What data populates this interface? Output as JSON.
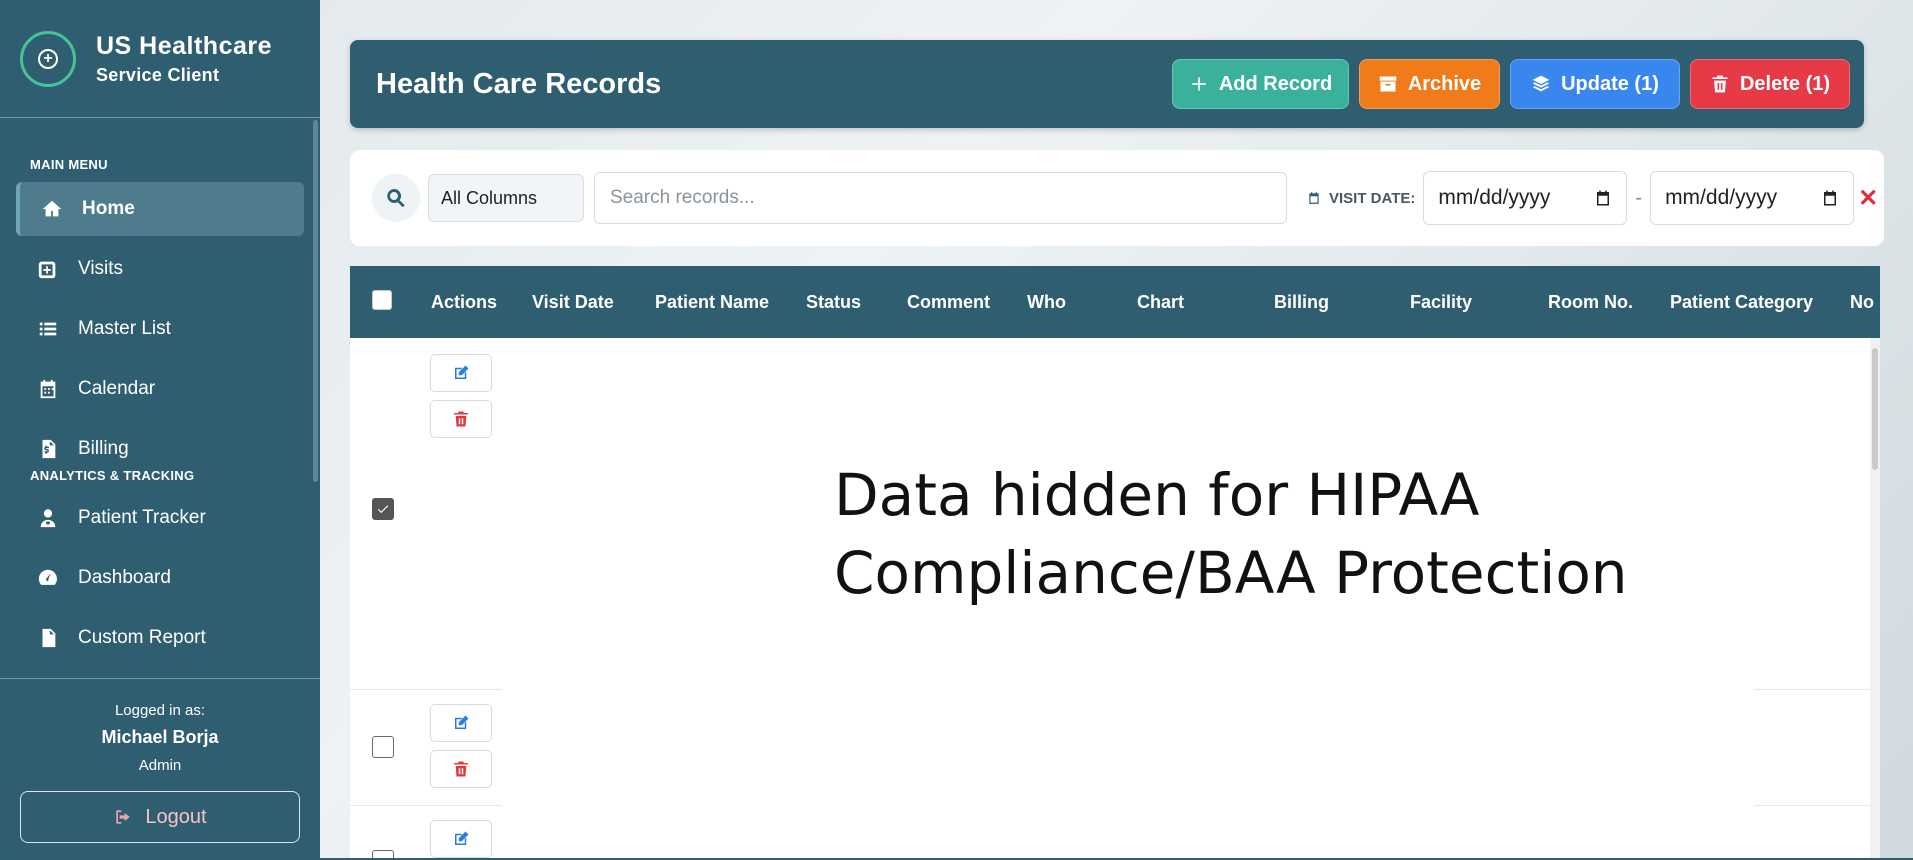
{
  "brand": {
    "title": "US Healthcare",
    "subtitle": "Service Client"
  },
  "sidebar": {
    "sections": {
      "main_menu": "MAIN MENU",
      "analytics": "ANALYTICS & TRACKING"
    },
    "items": [
      {
        "label": "Home",
        "icon": "home-icon",
        "active": true
      },
      {
        "label": "Visits",
        "icon": "calendar-plus-icon"
      },
      {
        "label": "Master List",
        "icon": "list-icon"
      },
      {
        "label": "Calendar",
        "icon": "calendar-icon"
      },
      {
        "label": "Billing",
        "icon": "invoice-icon"
      },
      {
        "label": "Patient Tracker",
        "icon": "user-doctor-icon"
      },
      {
        "label": "Dashboard",
        "icon": "gauge-icon"
      },
      {
        "label": "Custom Report",
        "icon": "file-icon"
      }
    ],
    "user": {
      "logged_in_label": "Logged in as:",
      "name": "Michael Borja",
      "role": "Admin"
    },
    "logout_label": "Logout"
  },
  "header": {
    "title": "Health Care Records",
    "buttons": {
      "add": "Add Record",
      "archive": "Archive",
      "update": "Update (1)",
      "delete": "Delete (1)"
    }
  },
  "search": {
    "column_filter": "All Columns",
    "placeholder": "Search records...",
    "date_label": "VISIT DATE:",
    "date_from": "mm/dd/yyyy",
    "date_to": "mm/dd/yyyy",
    "date_separator": "-",
    "clear_symbol": "✕"
  },
  "table": {
    "columns": [
      "Actions",
      "Visit Date",
      "Patient Name",
      "Status",
      "Comment",
      "Who",
      "Chart",
      "Billing",
      "Facility",
      "Room No.",
      "Patient Category",
      "No"
    ],
    "rows": [
      {
        "checked": true
      },
      {
        "checked": false
      },
      {
        "checked": false
      }
    ],
    "redaction_line1": "Data hidden for HIPAA",
    "redaction_line2": "Compliance/BAA Protection"
  },
  "colors": {
    "primary": "#2e5e70",
    "add": "#3bb09a",
    "archive": "#f07b1b",
    "update": "#3a86ef",
    "delete": "#e63b47"
  }
}
